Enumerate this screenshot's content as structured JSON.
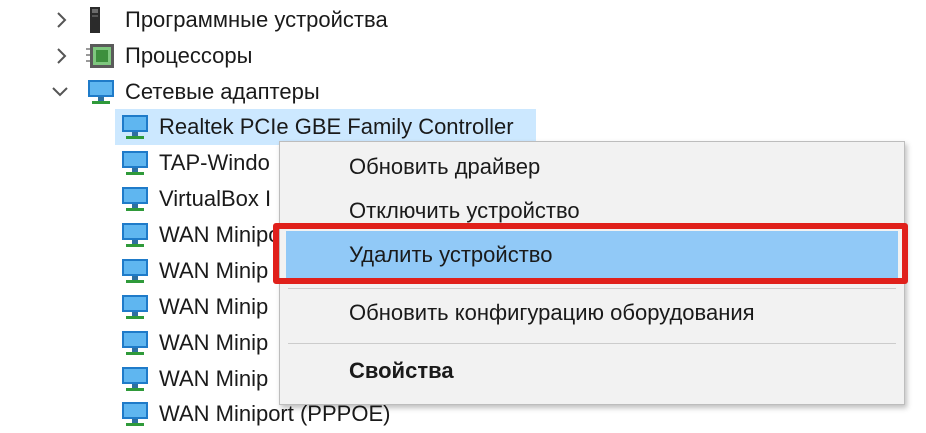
{
  "tree": {
    "categories": [
      {
        "label": "Программные устройства",
        "icon": "software-device-icon",
        "expanded": false
      },
      {
        "label": "Процессоры",
        "icon": "processor-chip-icon",
        "expanded": false
      },
      {
        "label": "Сетевые адаптеры",
        "icon": "network-adapter-icon",
        "expanded": true
      }
    ],
    "adapters": [
      {
        "label": "Realtek PCIe GBE Family Controller",
        "selected": true
      },
      {
        "label": "TAP-Windo"
      },
      {
        "label": "VirtualBox I"
      },
      {
        "label": "WAN Minipo"
      },
      {
        "label": "WAN Minip"
      },
      {
        "label": "WAN Minip"
      },
      {
        "label": "WAN Minip"
      },
      {
        "label": "WAN Minip"
      },
      {
        "label": "WAN Miniport (PPPOE)"
      }
    ]
  },
  "context_menu": {
    "items": [
      {
        "label": "Обновить драйвер"
      },
      {
        "label": "Отключить устройство"
      },
      {
        "label": "Удалить устройство",
        "highlighted": true
      },
      {
        "label": "Обновить конфигурацию оборудования"
      },
      {
        "label": "Свойства",
        "bold": true
      }
    ]
  },
  "colors": {
    "highlight": "#91c9f7",
    "selection": "#cce8ff",
    "annotation_red": "#e0201b"
  }
}
